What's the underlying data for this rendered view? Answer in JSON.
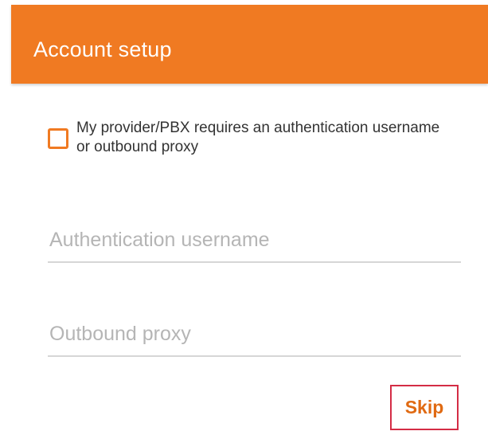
{
  "header": {
    "title": "Account setup",
    "background_color": "#f07a22"
  },
  "auth_option": {
    "checked": false,
    "label": "My provider/PBX requires an authentication username or outbound proxy",
    "accent_color": "#f07a22"
  },
  "fields": {
    "auth_username": {
      "value": "",
      "placeholder": "Authentication username"
    },
    "outbound_proxy": {
      "value": "",
      "placeholder": "Outbound proxy"
    }
  },
  "actions": {
    "skip_label": "Skip",
    "skip_color": "#e06a12",
    "skip_highlight_color": "#d42c45"
  }
}
